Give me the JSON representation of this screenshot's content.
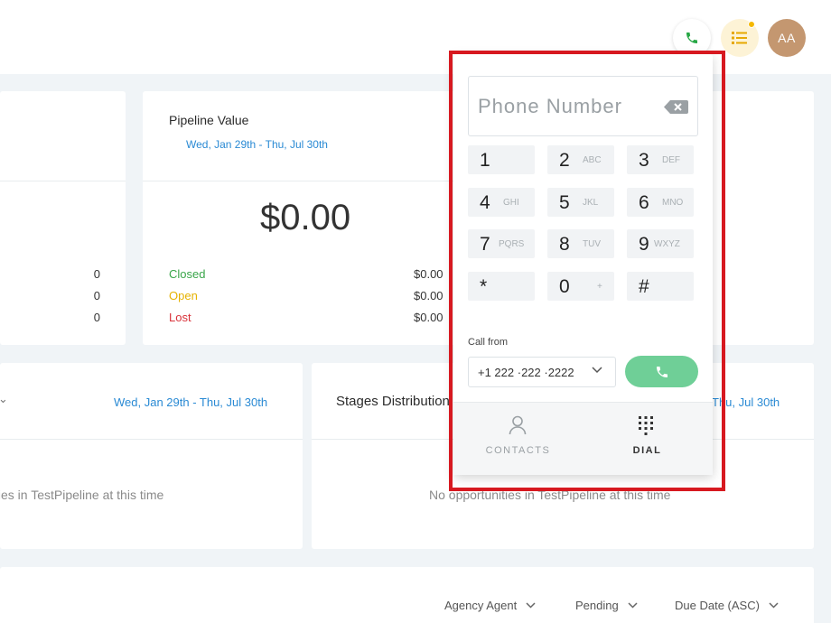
{
  "header": {
    "avatar_initials": "AA",
    "icons": [
      "phone-icon",
      "list-icon"
    ]
  },
  "pipeline_card": {
    "title": "Pipeline Value",
    "date_range": "Wed, Jan 29th - Thu, Jul 30th",
    "total": "$0.00",
    "rows": [
      {
        "label": "Closed",
        "value": "$0.00",
        "color": "#3aa64a"
      },
      {
        "label": "Open",
        "value": "$0.00",
        "color": "#e6b200"
      },
      {
        "label": "Lost",
        "value": "$0.00",
        "color": "#d9323a"
      }
    ]
  },
  "left_card": {
    "counts": [
      "0",
      "0",
      "0"
    ]
  },
  "row2": {
    "left_date": "Wed, Jan 29th - Thu, Jul 30th",
    "left_empty": "ties in TestPipeline at this time",
    "stages_title": "Stages Distribution",
    "stages_date": "Thu, Jul 30th",
    "stages_empty": "No opportunities in TestPipeline at this time"
  },
  "filters": {
    "agent": "Agency Agent",
    "status": "Pending",
    "sort": "Due Date (ASC)"
  },
  "dialer": {
    "phone_placeholder": "Phone Number",
    "keys": [
      {
        "digit": "1",
        "letters": ""
      },
      {
        "digit": "2",
        "letters": "ABC"
      },
      {
        "digit": "3",
        "letters": "DEF"
      },
      {
        "digit": "4",
        "letters": "GHI"
      },
      {
        "digit": "5",
        "letters": "JKL"
      },
      {
        "digit": "6",
        "letters": "MNO"
      },
      {
        "digit": "7",
        "letters": "PQRS"
      },
      {
        "digit": "8",
        "letters": "TUV"
      },
      {
        "digit": "9",
        "letters": "WXYZ"
      },
      {
        "digit": "*",
        "letters": ""
      },
      {
        "digit": "0",
        "letters": "+"
      },
      {
        "digit": "#",
        "letters": ""
      }
    ],
    "call_from_label": "Call from",
    "call_from_number": "+1 222 ·222 ·2222",
    "tabs": {
      "contacts": "CONTACTS",
      "dial": "DIAL"
    },
    "accent_color": "#6fcf97",
    "highlight_color": "#d71920"
  }
}
